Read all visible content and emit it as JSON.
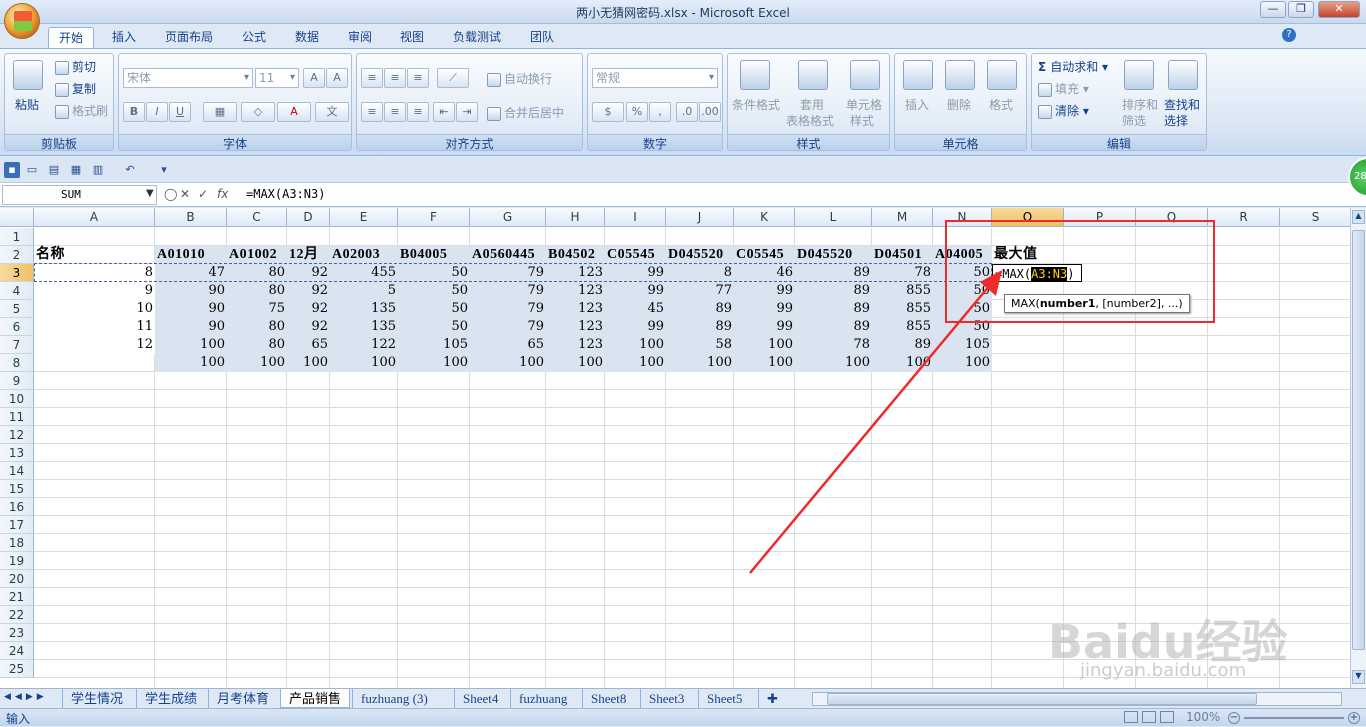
{
  "window": {
    "title": "两小无猜网密码.xlsx - Microsoft Excel",
    "minimize": "—",
    "restore": "❐",
    "close": "✕"
  },
  "tabs": [
    "开始",
    "插入",
    "页面布局",
    "公式",
    "数据",
    "审阅",
    "视图",
    "负载测试",
    "团队"
  ],
  "ribbon": {
    "clipboard": {
      "label": "剪贴板",
      "paste": "粘贴",
      "cut": "剪切",
      "copy": "复制",
      "format_painter": "格式刷"
    },
    "font": {
      "label": "字体",
      "font_name": "宋体",
      "font_size": "11",
      "bold": "B",
      "italic": "I",
      "underline": "U"
    },
    "alignment": {
      "label": "对齐方式",
      "wrap": "自动换行",
      "merge": "合并后居中"
    },
    "number": {
      "label": "数字",
      "format": "常规",
      "percent": "%",
      "comma": ","
    },
    "styles": {
      "label": "样式",
      "conditional": "条件格式",
      "table1": "套用",
      "table2": "表格格式",
      "cell1": "单元格",
      "cell2": "样式"
    },
    "cells": {
      "label": "单元格",
      "insert": "插入",
      "delete": "删除",
      "format": "格式"
    },
    "editing": {
      "label": "编辑",
      "autosum": "自动求和",
      "fill": "填充",
      "clear": "清除",
      "sort1": "排序和",
      "sort2": "筛选",
      "find1": "查找和",
      "find2": "选择"
    }
  },
  "formula_bar": {
    "name_box": "SUM",
    "formula": "=MAX(A3:N3)",
    "fx": "fx"
  },
  "columns": [
    "A",
    "B",
    "C",
    "D",
    "E",
    "F",
    "G",
    "H",
    "I",
    "J",
    "K",
    "L",
    "M",
    "N",
    "O",
    "P",
    "Q",
    "R",
    "S"
  ],
  "rows": [
    "1",
    "2",
    "3",
    "4",
    "5",
    "6",
    "7",
    "8",
    "9",
    "10",
    "11",
    "12",
    "13",
    "14",
    "15",
    "16",
    "17",
    "18",
    "19",
    "20",
    "21",
    "22",
    "23",
    "24",
    "25"
  ],
  "sheet": {
    "headers": [
      "名称",
      "A01010",
      "A01002",
      "12月",
      "A02003",
      "B04005",
      "A0560445",
      "B04502",
      "C05545",
      "D045520",
      "C05545",
      "D045520",
      "D04501",
      "A04005",
      "最大值"
    ],
    "data": [
      [
        "8",
        "47",
        "80",
        "92",
        "455",
        "50",
        "79",
        "123",
        "99",
        "8",
        "46",
        "89",
        "78",
        "50"
      ],
      [
        "9",
        "90",
        "80",
        "92",
        "5",
        "50",
        "79",
        "123",
        "99",
        "77",
        "99",
        "89",
        "855",
        "50"
      ],
      [
        "10",
        "90",
        "75",
        "92",
        "135",
        "50",
        "79",
        "123",
        "45",
        "89",
        "99",
        "89",
        "855",
        "50"
      ],
      [
        "11",
        "90",
        "80",
        "92",
        "135",
        "50",
        "79",
        "123",
        "99",
        "89",
        "99",
        "89",
        "855",
        "50"
      ],
      [
        "12",
        "100",
        "80",
        "65",
        "122",
        "105",
        "65",
        "123",
        "100",
        "58",
        "100",
        "78",
        "89",
        "105"
      ],
      [
        "",
        "100",
        "100",
        "100",
        "100",
        "100",
        "100",
        "100",
        "100",
        "100",
        "100",
        "100",
        "100",
        "100"
      ]
    ],
    "edit_prefix": "=MAX(",
    "edit_ref": "A3:N3",
    "edit_suffix": ")",
    "tooltip_fn": "MAX(",
    "tooltip_arg1": "number1",
    "tooltip_rest": ", [number2], ...)"
  },
  "sheet_tabs": [
    "学生情况",
    "学生成绩",
    "月考体育",
    "产品销售",
    "fuzhuang (3)",
    "Sheet4",
    "fuzhuang",
    "Sheet8",
    "Sheet3",
    "Sheet5"
  ],
  "active_sheet_index": 3,
  "status": {
    "mode": "输入",
    "zoom": "100%"
  },
  "watermark": {
    "brand": "Baidu经验",
    "url": "jingyan.baidu.com"
  },
  "side_badge": "28",
  "colors": {
    "accent_red": "#f02a2a",
    "selection_fill": "#dae4f1",
    "header_sel": "#f1c15f"
  }
}
